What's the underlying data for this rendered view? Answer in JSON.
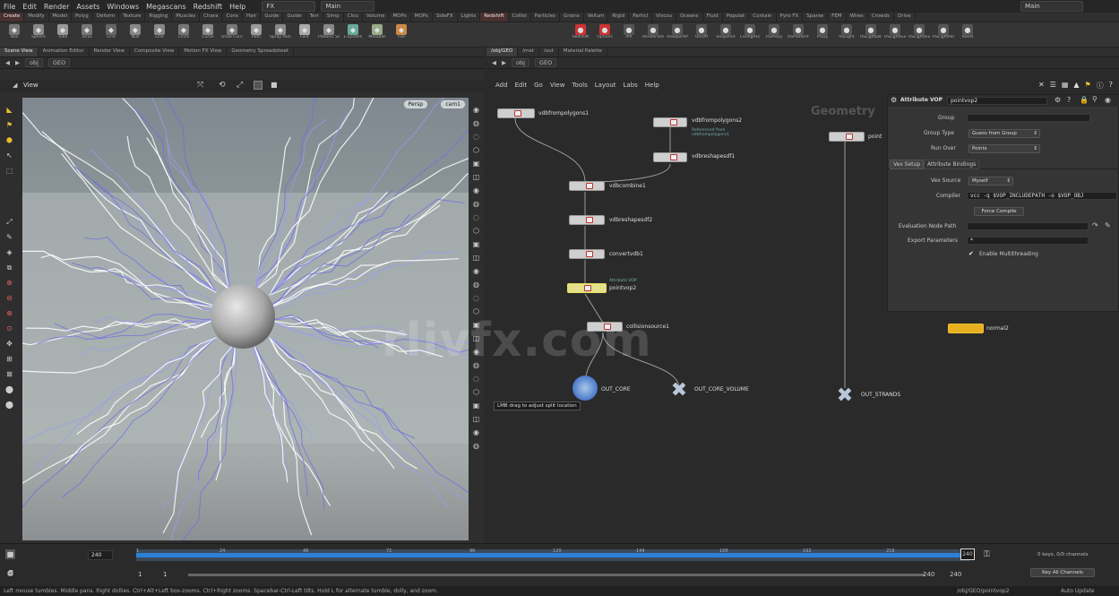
{
  "menu": [
    "File",
    "Edit",
    "Render",
    "Assets",
    "Windows",
    "Megascans",
    "Redshift",
    "Help"
  ],
  "desktops": {
    "left": "FX",
    "main": "Main",
    "right": "Main"
  },
  "shelf_tabs": [
    "Create",
    "Modify",
    "Model",
    "Polyg",
    "Deform",
    "Texture",
    "Rigging",
    "Muscles",
    "Chara",
    "Cons",
    "Hair",
    "Guide",
    "Guide",
    "Terr",
    "Simp",
    "Clou",
    "Volume",
    "MOPs",
    "MOPs",
    "SideFX",
    "Lights",
    "Redshift",
    "Collisi",
    "Particles",
    "Grains",
    "Vellum",
    "Rigid",
    "Particl",
    "Viscou",
    "Oceans",
    "Fluid",
    "Populat",
    "Contain",
    "Pyro FX",
    "Sparse",
    "FEM",
    "Wires",
    "Crowds",
    "Drive"
  ],
  "shelf_tools_left": [
    "Box",
    "Sphere",
    "Tube",
    "Torus",
    "Grid",
    "Null",
    "Line",
    "Circle",
    "Curve",
    "Draw Curve",
    "Path",
    "Spray Paint",
    "Font",
    "Platonic Solids",
    "L-System",
    "Metaball",
    "File"
  ],
  "shelf_tools_right": [
    "Redshift",
    "Options",
    "IPR",
    "RenderView",
    "ViewportIPR",
    "On/Off",
    "Snapshot",
    "ConfigAss",
    "RSProxy",
    "RSPlatform",
    "Proxy",
    "RSLight",
    "RSLightDome",
    "RSLightSun",
    "RSLightIES",
    "RSLightPortal",
    "Reset"
  ],
  "left_tabs": [
    "Scene View",
    "Animation Editor",
    "Render View",
    "Composite View",
    "Motion FX View",
    "Geometry Spreadsheet"
  ],
  "right_tabs": [
    "/obj/GEO",
    "/mat",
    "/out",
    "Material Palette"
  ],
  "left_path": {
    "ctx": "obj",
    "node": "GEO"
  },
  "right_path": {
    "ctx": "obj",
    "node": "GEO"
  },
  "viewport": {
    "title": "View",
    "persp": "Persp",
    "cam": "cam1"
  },
  "network_menu": [
    "Add",
    "Edit",
    "Go",
    "View",
    "Tools",
    "Layout",
    "Labs",
    "Help"
  ],
  "nodes": [
    {
      "id": "vdbfrompolygons1",
      "label": "vdbfrompolygons1"
    },
    {
      "id": "vdbfrompolygons2",
      "label": "vdbfrompolygons2",
      "tag": "Referenced from vdbfrompolygons1"
    },
    {
      "id": "vdbreshapesdf1",
      "label": "vdbreshapesdf1"
    },
    {
      "id": "vdbcombine1",
      "label": "vdbcombine1"
    },
    {
      "id": "vdbreshapesdf2",
      "label": "vdbreshapesdf2"
    },
    {
      "id": "convertvdb1",
      "label": "convertvdb1"
    },
    {
      "id": "pointvop2",
      "label": "pointvop2",
      "tag": "Attribute VOP"
    },
    {
      "id": "collisionsource1",
      "label": "collisionsource1"
    },
    {
      "id": "out_core",
      "label": "OUT_CORE"
    },
    {
      "id": "out_core_volume",
      "label": "OUT_CORE_VOLUME"
    },
    {
      "id": "out_strands",
      "label": "OUT_STRANDS"
    },
    {
      "id": "normal2",
      "label": "normal2"
    },
    {
      "id": "point_top",
      "label": "point"
    }
  ],
  "geometry_watermark": "Geometry",
  "tooltip": "LMB drag to adjust split location",
  "params": {
    "type": "Attribute VOP",
    "name": "pointvop2",
    "group_label": "Group",
    "group_type_label": "Group Type",
    "group_type_value": "Guess from Group",
    "run_over_label": "Run Over",
    "run_over_value": "Points",
    "tabs": [
      "Vex Setup",
      "Attribute Bindings"
    ],
    "vex_source_label": "Vex Source",
    "vex_source_value": "Myself",
    "compiler_label": "Compiler",
    "compiler_value": "vcc -q $VOP_INCLUDEPATH -o $VOP_OBJ",
    "force_compile": "Force Compile",
    "eval_path_label": "Evaluation Node Path",
    "export_params_label": "Export Parameters",
    "export_params_value": "*",
    "multithread_label": "Enable Multithreading"
  },
  "timeline": {
    "frame": "240",
    "start": "1",
    "start2": "1",
    "end": "240",
    "end2": "240",
    "current": "240",
    "ticks": [
      "1",
      "24",
      "48",
      "72",
      "96",
      "120",
      "144",
      "168",
      "192",
      "216"
    ],
    "keys": "0 keys, 0/0 channels",
    "key_all": "Key All Channels",
    "auto_update": "Auto Update"
  },
  "status": "Left mouse tumbles. Middle pans. Right dollies. Ctrl+Alt+Left box-zooms. Ctrl+Right zooms. Spacebar-Ctrl-Left tilts. Hold L for alternate tumble, dolly, and zoom.",
  "status_path": "/obj/GEO/pointvop2",
  "watermark": "rlivfx.com"
}
